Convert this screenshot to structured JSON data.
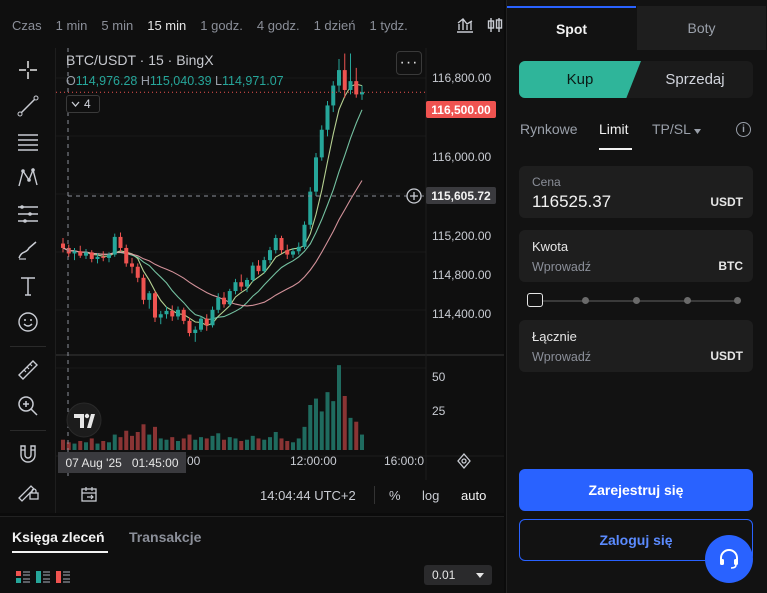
{
  "timeframes": [
    "Czas",
    "1 min",
    "5 min",
    "15 min",
    "1 godz.",
    "4 godz.",
    "1 dzień",
    "1 tydz."
  ],
  "active_timeframe": "15 min",
  "symbol": {
    "title": "BTC/USDT · 15 · BingX",
    "open_label": "O",
    "open": "114,976.28",
    "high_label": "H",
    "high": "115,040.39",
    "low_label": "L",
    "low": "114,971.07",
    "indicators_count": "4",
    "more_label": "···"
  },
  "price_scale": [
    "116,800.00",
    "116,000.00",
    "115,200.00",
    "114,800.00",
    "114,400.00"
  ],
  "last_price_tag": "116,500.00",
  "crosshair_price_tag": "115,605.72",
  "volume_scale": [
    "50",
    "25"
  ],
  "crosshair_date": "07 Aug '25",
  "crosshair_time": "01:45:00",
  "time_axis": [
    "00",
    "12:00:00",
    "16:00:0"
  ],
  "bottom_bar": {
    "clock": "14:04:44 UTC+2",
    "percent": "%",
    "log": "log",
    "auto": "auto"
  },
  "colors": {
    "up": "#26a69a",
    "down": "#ef5350",
    "accent": "#2962ff",
    "buy": "#2fb59a"
  },
  "order_book": {
    "tabs": [
      "Księga zleceń",
      "Transakcje"
    ],
    "precision": "0.01"
  },
  "trade_panel": {
    "mode_tabs": [
      "Spot",
      "Boty"
    ],
    "buy_label": "Kup",
    "sell_label": "Sprzedaj",
    "order_types": [
      "Rynkowe",
      "Limit",
      "TP/SL"
    ],
    "active_order_type": "Limit",
    "price_label": "Cena",
    "price_value": "116525.37",
    "price_unit": "USDT",
    "amount_label": "Kwota",
    "amount_placeholder": "Wprowadź",
    "amount_unit": "BTC",
    "total_label": "Łącznie",
    "total_placeholder": "Wprowadź",
    "total_unit": "USDT",
    "register_label": "Zarejestruj się",
    "login_label": "Zaloguj się"
  },
  "chart_data": {
    "type": "candlestick",
    "price_range": [
      114130,
      116900
    ],
    "volume_range": [
      0,
      70
    ],
    "candles": [
      [
        115130,
        115180,
        115050,
        115090,
        8
      ],
      [
        115090,
        115120,
        115010,
        115040,
        6
      ],
      [
        115040,
        115090,
        114980,
        115060,
        5
      ],
      [
        115060,
        115110,
        115000,
        115020,
        7
      ],
      [
        115020,
        115080,
        114990,
        115050,
        6
      ],
      [
        115050,
        115070,
        114960,
        114990,
        9
      ],
      [
        114990,
        115040,
        114950,
        115010,
        5
      ],
      [
        115010,
        115060,
        114970,
        115000,
        7
      ],
      [
        115000,
        115050,
        114960,
        115030,
        6
      ],
      [
        115030,
        115220,
        115010,
        115190,
        12
      ],
      [
        115190,
        115230,
        115060,
        115090,
        10
      ],
      [
        115090,
        115120,
        114920,
        114950,
        15
      ],
      [
        114950,
        115000,
        114860,
        114920,
        11
      ],
      [
        114920,
        114950,
        114780,
        114820,
        14
      ],
      [
        114820,
        114850,
        114580,
        114620,
        20
      ],
      [
        114620,
        114700,
        114540,
        114680,
        12
      ],
      [
        114680,
        114700,
        114420,
        114460,
        18
      ],
      [
        114460,
        114520,
        114400,
        114490,
        9
      ],
      [
        114490,
        114560,
        114450,
        114520,
        8
      ],
      [
        114520,
        114570,
        114430,
        114470,
        10
      ],
      [
        114470,
        114560,
        114440,
        114530,
        7
      ],
      [
        114530,
        114550,
        114400,
        114430,
        9
      ],
      [
        114430,
        114460,
        114290,
        114320,
        12
      ],
      [
        114320,
        114380,
        114240,
        114350,
        8
      ],
      [
        114350,
        114470,
        114330,
        114450,
        10
      ],
      [
        114450,
        114490,
        114340,
        114390,
        9
      ],
      [
        114390,
        114560,
        114370,
        114530,
        11
      ],
      [
        114530,
        114680,
        114500,
        114640,
        13
      ],
      [
        114640,
        114690,
        114550,
        114580,
        8
      ],
      [
        114580,
        114720,
        114560,
        114700,
        10
      ],
      [
        114700,
        114810,
        114670,
        114780,
        9
      ],
      [
        114780,
        114850,
        114700,
        114740,
        7
      ],
      [
        114740,
        114820,
        114690,
        114800,
        8
      ],
      [
        114800,
        114960,
        114780,
        114930,
        11
      ],
      [
        114930,
        114980,
        114850,
        114880,
        9
      ],
      [
        114880,
        115010,
        114860,
        114980,
        8
      ],
      [
        114980,
        115100,
        114950,
        115070,
        10
      ],
      [
        115070,
        115210,
        115040,
        115180,
        14
      ],
      [
        115180,
        115200,
        115040,
        115070,
        9
      ],
      [
        115070,
        115120,
        114990,
        115030,
        7
      ],
      [
        115030,
        115090,
        115000,
        115060,
        6
      ],
      [
        115060,
        115140,
        115030,
        115100,
        9
      ],
      [
        115100,
        115330,
        115080,
        115300,
        18
      ],
      [
        115300,
        115640,
        115260,
        115600,
        35
      ],
      [
        115600,
        115950,
        115560,
        115910,
        40
      ],
      [
        115910,
        116200,
        115880,
        116160,
        30
      ],
      [
        116160,
        116420,
        116100,
        116380,
        45
      ],
      [
        116380,
        116600,
        116320,
        116560,
        38
      ],
      [
        116560,
        116800,
        116500,
        116700,
        66
      ],
      [
        116700,
        116850,
        116450,
        116520,
        42
      ],
      [
        116520,
        116850,
        116480,
        116600,
        25
      ],
      [
        116600,
        116720,
        116450,
        116480,
        22
      ],
      [
        116480,
        116560,
        116430,
        116500,
        12
      ]
    ]
  }
}
